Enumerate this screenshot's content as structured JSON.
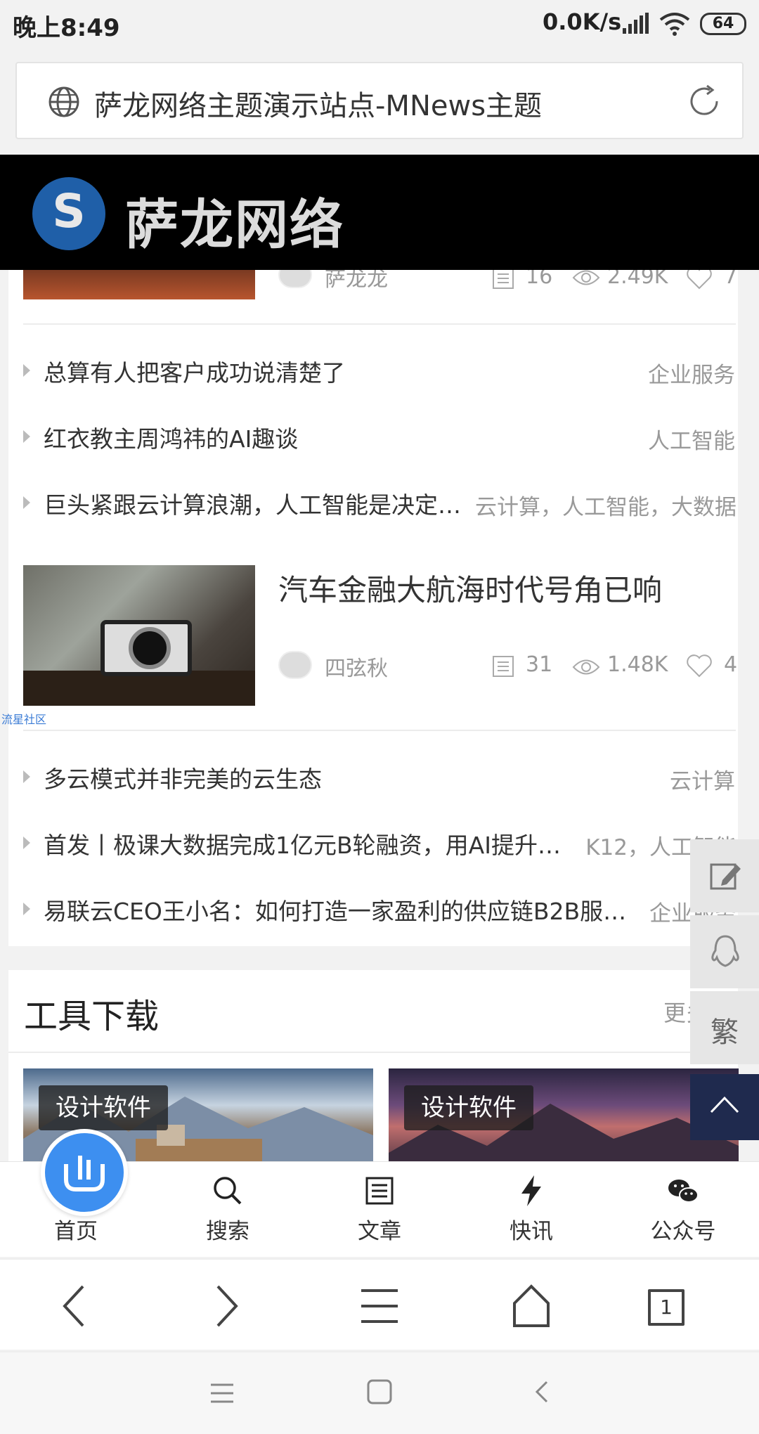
{
  "status_bar": {
    "time": "晚上8:49",
    "network_speed": "0.0K/s",
    "battery": "64"
  },
  "address_bar": {
    "title": "萨龙网络主题演示站点-MNews主题",
    "globe_icon": "globe-icon",
    "refresh_icon": "refresh-icon"
  },
  "site_header": {
    "logo_letter": "S",
    "logo_text": "萨龙网络"
  },
  "article_top": {
    "author": "萨龙龙",
    "comments": "16",
    "views": "2.49K",
    "likes": "7"
  },
  "list_group_1": [
    {
      "title": "总算有人把客户成功说清楚了",
      "category": "企业服务"
    },
    {
      "title": "红衣教主周鸿祎的AI趣谈",
      "category": "人工智能"
    },
    {
      "title": "巨头紧跟云计算浪潮，人工智能是决定…",
      "category": "云计算，人工智能，大数据"
    }
  ],
  "featured_article": {
    "title": "汽车金融大航海时代号角已响",
    "author": "四弦秋",
    "comments": "31",
    "views": "1.48K",
    "likes": "4"
  },
  "watermark": "流星社区",
  "list_group_2": [
    {
      "title": "多云模式并非完美的云生态",
      "category": "云计算"
    },
    {
      "title": "首发丨极课大数据完成1亿元B轮融资，用AI提升…",
      "category": "K12，人工智能"
    },
    {
      "title": "易联云CEO王小名：如何打造一家盈利的供应链B2B服…",
      "category": "企业服务"
    }
  ],
  "tools_section": {
    "title": "工具下载",
    "more": "更多",
    "tiles": [
      {
        "badge": "设计软件"
      },
      {
        "badge": "设计软件"
      }
    ]
  },
  "float_buttons": {
    "edit": "edit-icon",
    "qq": "qq-icon",
    "traditional": "繁",
    "top": "back-to-top-icon"
  },
  "tab_bar": [
    {
      "label": "首页",
      "icon": "home-logo-icon"
    },
    {
      "label": "搜索",
      "icon": "search-icon"
    },
    {
      "label": "文章",
      "icon": "article-icon"
    },
    {
      "label": "快讯",
      "icon": "flash-icon"
    },
    {
      "label": "公众号",
      "icon": "wechat-icon"
    }
  ],
  "browser_bar": {
    "tabs_count": "1"
  },
  "colors": {
    "accent": "#3d8ff0",
    "header_bg": "#000000",
    "top_button": "#1f2a4e",
    "logo_blue": "#1f5fa8"
  }
}
